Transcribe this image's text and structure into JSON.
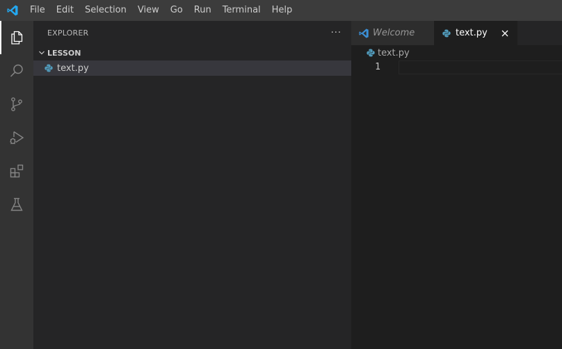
{
  "menu": {
    "items": [
      "File",
      "Edit",
      "Selection",
      "View",
      "Go",
      "Run",
      "Terminal",
      "Help"
    ]
  },
  "activity_bar": {
    "icons": [
      "explorer-icon",
      "search-icon",
      "source-control-icon",
      "run-debug-icon",
      "extensions-icon",
      "testing-icon"
    ],
    "active": "explorer-icon"
  },
  "sidebar": {
    "title": "EXPLORER",
    "more": "···",
    "section": {
      "title": "LESSON",
      "files": [
        {
          "label": "text.py",
          "icon": "python-icon"
        }
      ]
    }
  },
  "editor": {
    "tabs": [
      {
        "label": "Welcome",
        "icon": "vscode-icon",
        "active": false
      },
      {
        "label": "text.py",
        "icon": "python-icon",
        "active": true,
        "close": "✕"
      }
    ],
    "breadcrumb": "text.py",
    "lines": [
      "1"
    ]
  },
  "colors": {
    "titlebar": "#3c3c3c",
    "activitybar": "#333333",
    "sidebar": "#252526",
    "editor": "#1e1e1e",
    "accent": "#0078d4",
    "python_blue": "#519aba"
  }
}
